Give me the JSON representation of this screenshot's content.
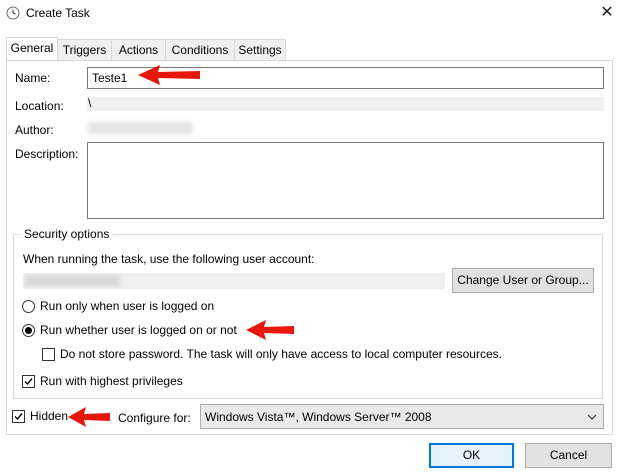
{
  "window": {
    "title": "Create Task",
    "close_glyph": "✕"
  },
  "tabs": [
    {
      "label": "General",
      "active": true
    },
    {
      "label": "Triggers"
    },
    {
      "label": "Actions"
    },
    {
      "label": "Conditions"
    },
    {
      "label": "Settings"
    }
  ],
  "general": {
    "name_label": "Name:",
    "name_value": "Teste1",
    "location_label": "Location:",
    "location_value": "\\",
    "author_label": "Author:",
    "description_label": "Description:"
  },
  "security": {
    "group_title": "Security options",
    "account_prompt": "When running the task, use the following user account:",
    "change_user_button": "Change User or Group...",
    "radio_logged_on": "Run only when user is logged on",
    "radio_whether": "Run whether user is logged on or not",
    "no_store_password": "Do not store password.  The task will only have access to local computer resources.",
    "highest_privileges": "Run with highest privileges"
  },
  "footer": {
    "hidden_label": "Hidden",
    "configure_label": "Configure for:",
    "configure_value": "Windows Vista™, Windows Server™ 2008",
    "ok_button": "OK",
    "cancel_button": "Cancel"
  },
  "colors": {
    "annotation_arrow": "#e8170c",
    "focus_blue": "#0078d7"
  }
}
